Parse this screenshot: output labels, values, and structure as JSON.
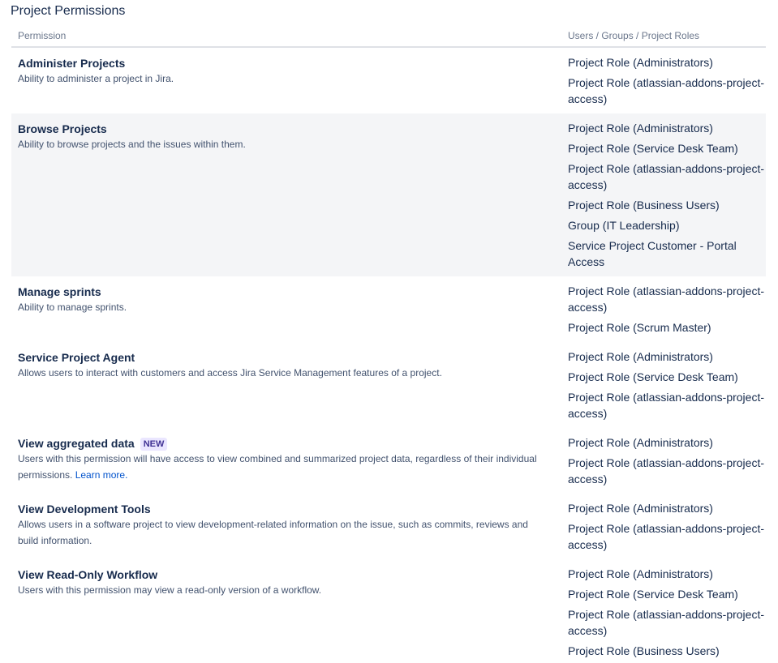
{
  "page_title": "Project Permissions",
  "columns": {
    "permission": "Permission",
    "roles": "Users / Groups / Project Roles"
  },
  "permissions": [
    {
      "name": "Administer Projects",
      "description": "Ability to administer a project in Jira.",
      "roles": [
        "Project Role (Administrators)",
        "Project Role (atlassian-addons-project-access)"
      ]
    },
    {
      "name": "Browse Projects",
      "description": "Ability to browse projects and the issues within them.",
      "roles": [
        "Project Role (Administrators)",
        "Project Role (Service Desk Team)",
        "Project Role (atlassian-addons-project-access)",
        "Project Role (Business Users)",
        "Group (IT Leadership)",
        "Service Project Customer - Portal Access"
      ]
    },
    {
      "name": "Manage sprints",
      "description": "Ability to manage sprints.",
      "roles": [
        "Project Role (atlassian-addons-project-access)",
        "Project Role (Scrum Master)"
      ]
    },
    {
      "name": "Service Project Agent",
      "description": "Allows users to interact with customers and access Jira Service Management features of a project.",
      "roles": [
        "Project Role (Administrators)",
        "Project Role (Service Desk Team)",
        "Project Role (atlassian-addons-project-access)"
      ]
    },
    {
      "name": "View aggregated data",
      "badge": "NEW",
      "description": "Users with this permission will have access to view combined and summarized project data, regardless of their individual permissions.",
      "link": "Learn more.",
      "roles": [
        "Project Role (Administrators)",
        "Project Role (atlassian-addons-project-access)"
      ]
    },
    {
      "name": "View Development Tools",
      "description": "Allows users in a software project to view development-related information on the issue, such as commits, reviews and build information.",
      "roles": [
        "Project Role (Administrators)",
        "Project Role (atlassian-addons-project-access)"
      ]
    },
    {
      "name": "View Read-Only Workflow",
      "description": "Users with this permission may view a read-only version of a workflow.",
      "roles": [
        "Project Role (Administrators)",
        "Project Role (Service Desk Team)",
        "Project Role (atlassian-addons-project-access)",
        "Project Role (Business Users)"
      ]
    }
  ]
}
